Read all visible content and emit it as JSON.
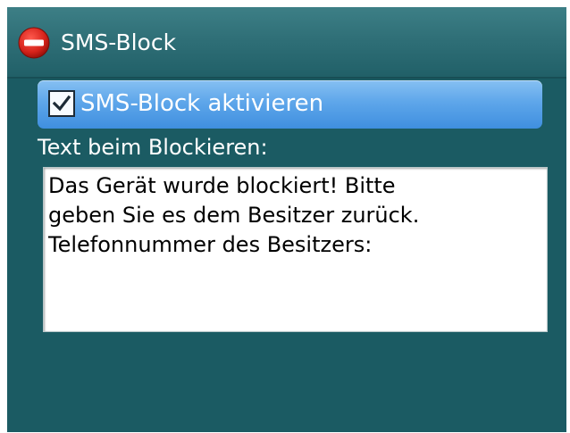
{
  "app": {
    "title": "SMS-Block",
    "icon": "no-entry-icon"
  },
  "settings": {
    "activate_label": "SMS-Block aktivieren",
    "activate_checked": true,
    "block_text_label": "Text beim Blockieren:",
    "block_text_lines": [
      "Das Gerät wurde blockiert! Bitte",
      "geben Sie es dem Besitzer zurück.",
      "Telefonnummer des Besitzers:"
    ]
  },
  "colors": {
    "screen_background": "#1b5b63",
    "titlebar": "#2f6f77",
    "selection_highlight": "#5ea6ea",
    "icon_red": "#d6231b",
    "text_light": "#ffffff",
    "text_dark": "#000000"
  }
}
